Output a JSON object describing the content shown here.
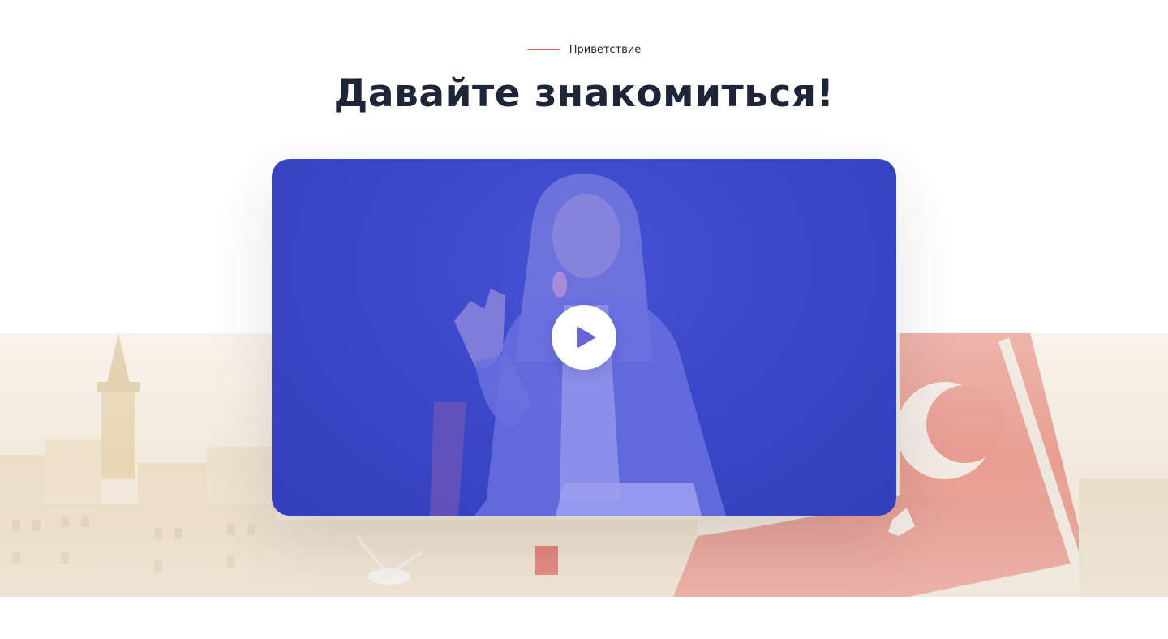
{
  "section": {
    "eyebrow": "Приветствие",
    "title": "Давайте знакомиться!"
  },
  "video": {
    "play_icon": "play-icon",
    "overlay_color": "#3a47c7"
  },
  "colors": {
    "accent_line": "#e06a5a",
    "heading": "#1f2538",
    "play_triangle": "#6a62d8"
  }
}
